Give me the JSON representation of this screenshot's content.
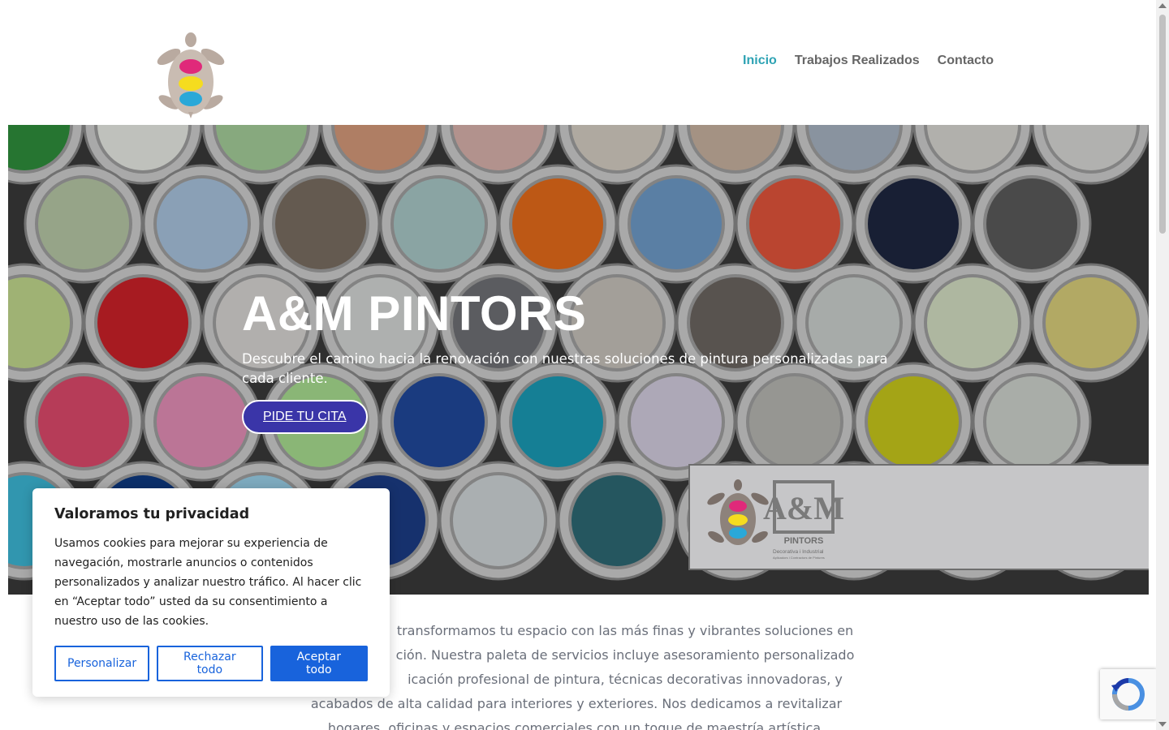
{
  "header": {
    "nav": [
      {
        "label": "Inicio",
        "active": true
      },
      {
        "label": "Trabajos Realizados",
        "active": false
      },
      {
        "label": "Contacto",
        "active": false
      }
    ]
  },
  "hero": {
    "title": "A&M PINTORS",
    "subtitle": "Descubre el camino hacia la renovación con nuestras soluciones de pintura personalizadas para cada cliente.",
    "cta_label": "PIDE TU CITA",
    "banner": {
      "logo_text": "A&M",
      "logo_name": "PINTORS",
      "tagline": "Decorativa i Industrial",
      "tagline_small": "Aplicadors i Contractors de Pintures"
    }
  },
  "intro": {
    "line1": "transformamos tu espacio con las más finas y vibrantes soluciones en",
    "line2": "ción. Nuestra paleta de servicios incluye asesoramiento personalizado",
    "line3": "icación profesional de pintura, técnicas decorativas innovadoras, y",
    "line4": "acabados de alta calidad para interiores y exteriores. Nos dedicamos a revitalizar",
    "line5": "hogares, oficinas y espacios comerciales con un toque de maestría artística."
  },
  "cookie": {
    "title": "Valoramos tu privacidad",
    "text": "Usamos cookies para mejorar su experiencia de navegación, mostrarle anuncios o contenidos personalizados y analizar nuestro tráfico. Al hacer clic en “Aceptar todo” usted da su consentimiento a nuestro uso de las cookies.",
    "customize_label": "Personalizar",
    "reject_label": "Rechazar todo",
    "accept_label": "Aceptar todo"
  },
  "colors": {
    "accent": "#2ea3b4",
    "cta": "#3a35a8",
    "cookie_button": "#1863dc",
    "logo_magenta": "#e0297a",
    "logo_yellow": "#f5dc1f",
    "logo_cyan": "#2aa8d8"
  },
  "icons": {
    "logo": "turtle-cmy-logo",
    "recaptcha": "recaptcha-icon"
  }
}
